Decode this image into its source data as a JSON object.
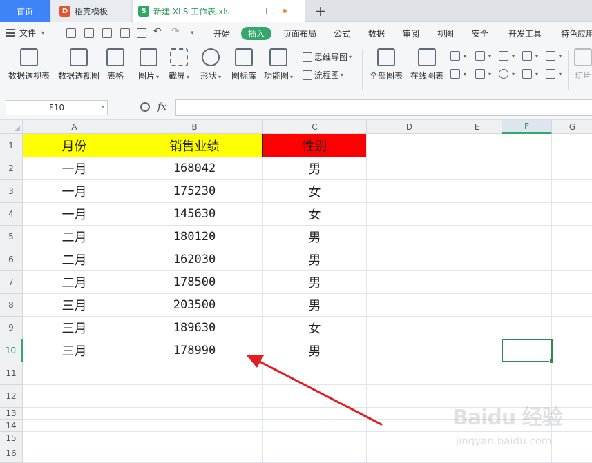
{
  "tabs": {
    "home": "首页",
    "template": "稻壳模板",
    "file": "新建 XLS 工作表.xls"
  },
  "menu": {
    "file": "文件",
    "items": [
      "开始",
      "插入",
      "页面布局",
      "公式",
      "数据",
      "审阅",
      "视图",
      "安全",
      "开发工具",
      "特色应用"
    ],
    "active_index": 1
  },
  "ribbon": {
    "large": [
      "数据透视表",
      "数据透视图",
      "表格",
      "图片",
      "截屏",
      "形状",
      "图标库",
      "功能图"
    ],
    "small": [
      "思维导图",
      "流程图"
    ],
    "charts": [
      "全部图表",
      "在线图表"
    ],
    "cut": "切片"
  },
  "formula_bar": {
    "name_box": "F10",
    "fx": "fx",
    "formula": ""
  },
  "columns": [
    "A",
    "B",
    "C",
    "D",
    "E",
    "F",
    "G"
  ],
  "rows": [
    "1",
    "2",
    "3",
    "4",
    "5",
    "6",
    "7",
    "8",
    "9",
    "10",
    "11",
    "12",
    "13",
    "14",
    "15",
    "16"
  ],
  "table": {
    "headers": [
      "月份",
      "销售业绩",
      "性别"
    ],
    "data": [
      [
        "一月",
        "168042",
        "男"
      ],
      [
        "一月",
        "175230",
        "女"
      ],
      [
        "一月",
        "145630",
        "女"
      ],
      [
        "二月",
        "180120",
        "男"
      ],
      [
        "二月",
        "162030",
        "男"
      ],
      [
        "二月",
        "178500",
        "男"
      ],
      [
        "三月",
        "203500",
        "男"
      ],
      [
        "三月",
        "189630",
        "女"
      ],
      [
        "三月",
        "178990",
        "男"
      ]
    ]
  },
  "colors": {
    "header_yellow": "#ffff00",
    "header_red": "#ff0000",
    "accent_green": "#34a86a",
    "tab_blue": "#3f84f7",
    "arrow_red": "#e02020"
  },
  "watermark": {
    "main": "Baidu 经验",
    "sub": "jingyan.baidu.com"
  }
}
